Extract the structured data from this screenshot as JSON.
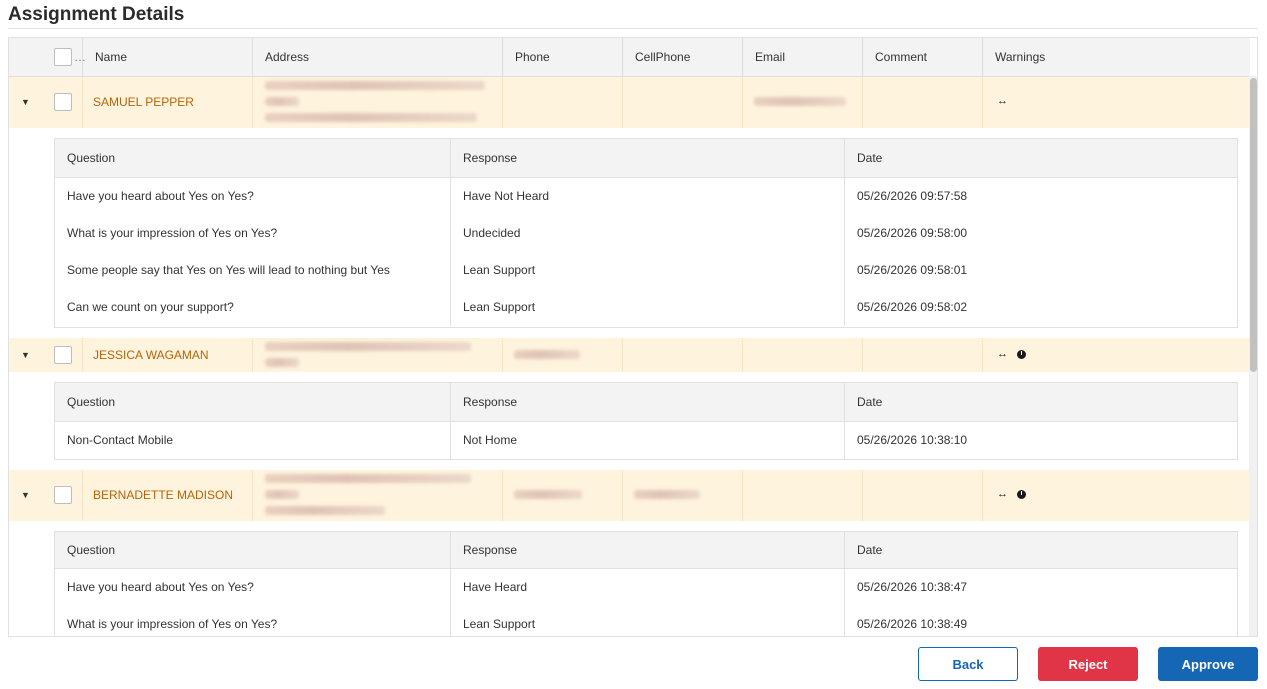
{
  "page": {
    "title": "Assignment Details"
  },
  "columns": [
    "Name",
    "Address",
    "Phone",
    "CellPhone",
    "Email",
    "Comment",
    "Warnings"
  ],
  "header_checkbox_ellipsis": "…",
  "detail_columns": [
    "Question",
    "Response",
    "Date"
  ],
  "records": [
    {
      "name": "SAMUEL PEPPER",
      "warnings": [
        "swap-icon"
      ],
      "responses": [
        {
          "question": "Have you heard about Yes on Yes?",
          "response": "Have Not Heard",
          "date": "05/26/2026 09:57:58"
        },
        {
          "question": "What is your impression of Yes on Yes?",
          "response": "Undecided",
          "date": "05/26/2026 09:58:00"
        },
        {
          "question": "Some people say that Yes on Yes will lead to nothing but Yes",
          "response": "Lean Support",
          "date": "05/26/2026 09:58:01"
        },
        {
          "question": "Can we count on your support?",
          "response": "Lean Support",
          "date": "05/26/2026 09:58:02"
        }
      ]
    },
    {
      "name": "JESSICA WAGAMAN",
      "warnings": [
        "swap-icon",
        "clock-icon"
      ],
      "responses": [
        {
          "question": "Non-Contact Mobile",
          "response": "Not Home",
          "date": "05/26/2026 10:38:10"
        }
      ]
    },
    {
      "name": "BERNADETTE MADISON",
      "warnings": [
        "swap-icon",
        "clock-icon"
      ],
      "responses": [
        {
          "question": "Have you heard about Yes on Yes?",
          "response": "Have Heard",
          "date": "05/26/2026 10:38:47"
        },
        {
          "question": "What is your impression of Yes on Yes?",
          "response": "Lean Support",
          "date": "05/26/2026 10:38:49"
        }
      ]
    }
  ],
  "buttons": {
    "back": "Back",
    "reject": "Reject",
    "approve": "Approve"
  },
  "icons": {
    "expand": "▼",
    "swap": "↔"
  },
  "colors": {
    "row_highlight": "#fef3dc",
    "name_text": "#b5650b",
    "primary": "#1567b5",
    "danger": "#e03546"
  }
}
